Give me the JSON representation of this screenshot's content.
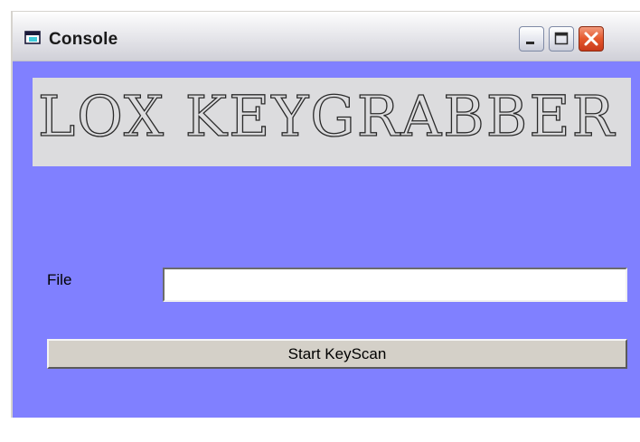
{
  "window": {
    "title": "Console",
    "icon": "console-window-icon",
    "controls": [
      "minimize-icon",
      "maximize-icon",
      "close-icon"
    ],
    "background_color": "#8080ff"
  },
  "banner": {
    "text": "LOX KEYGRABBER"
  },
  "file": {
    "label": "File",
    "value": ""
  },
  "actions": {
    "start_label": "Start KeyScan"
  }
}
